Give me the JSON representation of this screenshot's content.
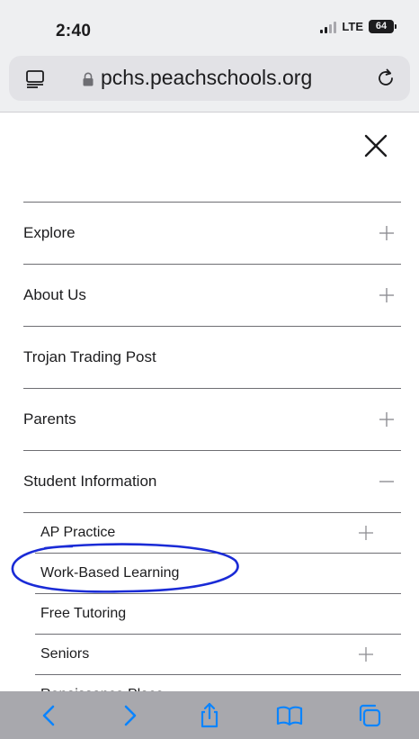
{
  "status_bar": {
    "time": "2:40",
    "network": "LTE",
    "battery": "64"
  },
  "browser": {
    "url": "pcHs.peachschools.org",
    "url_display": "pchs.peachschools.org",
    "accent_color": "#0a84ff"
  },
  "menu": {
    "items": [
      {
        "label": "Explore",
        "toggle": "plus-icon"
      },
      {
        "label": "About Us",
        "toggle": "plus-icon"
      },
      {
        "label": "Trojan Trading Post",
        "toggle": ""
      },
      {
        "label": "Parents",
        "toggle": "plus-icon"
      },
      {
        "label": "Student Information",
        "toggle": "minus-icon"
      }
    ],
    "subitems": [
      {
        "label": "AP Practice",
        "toggle": "plus-icon"
      },
      {
        "label": "Work-Based Learning",
        "toggle": ""
      },
      {
        "label": "Free Tutoring",
        "toggle": ""
      },
      {
        "label": "Seniors",
        "toggle": "plus-icon"
      },
      {
        "label": "Renaissance Place",
        "toggle": ""
      }
    ]
  },
  "annotation": {
    "color": "#1a2bd6",
    "target": "Work-Based Learning"
  },
  "toolbar": {
    "icons": [
      "back-icon",
      "forward-icon",
      "share-icon",
      "bookmarks-icon",
      "tabs-overview-icon"
    ]
  }
}
